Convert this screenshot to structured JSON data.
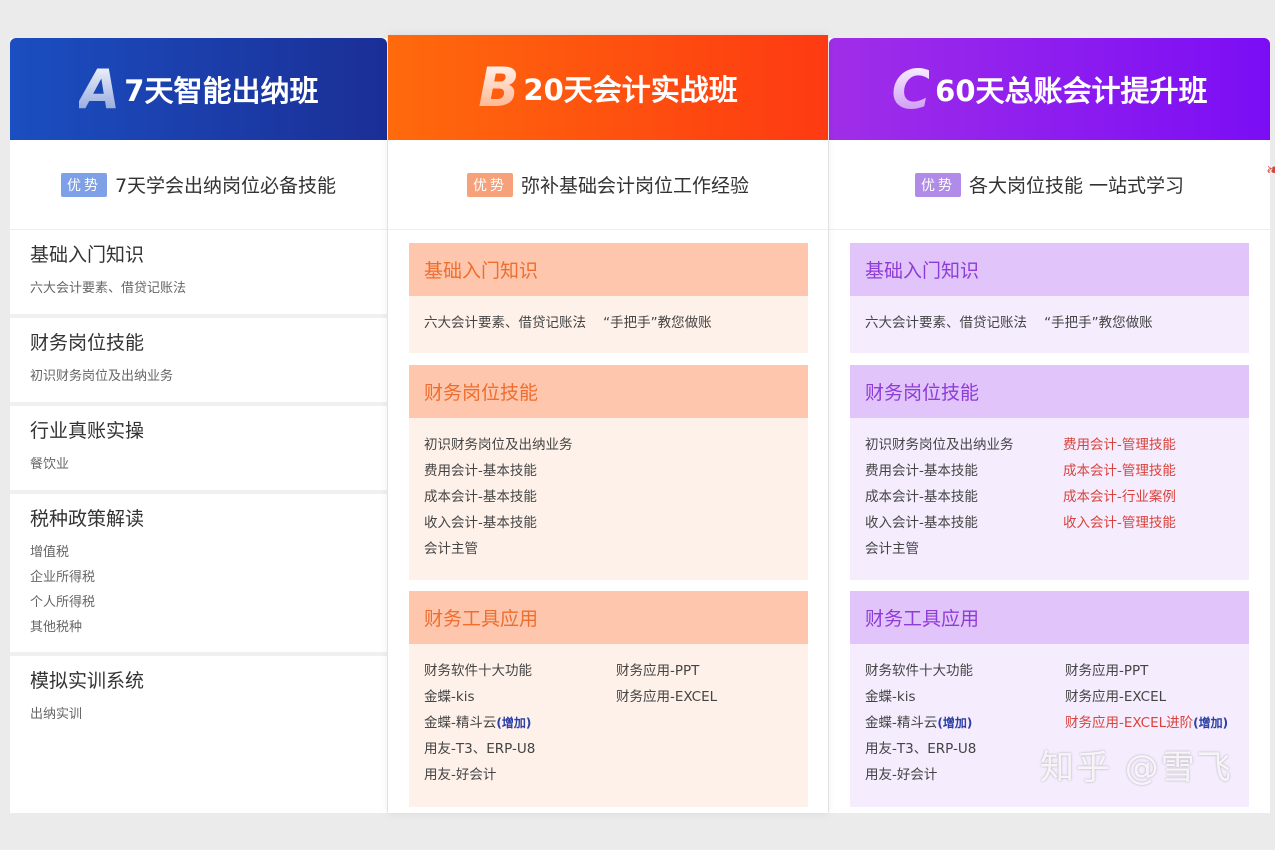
{
  "plans": {
    "a": {
      "letter": "A",
      "title": "7天智能出纳班",
      "badge": "优势",
      "advantage": "7天学会出纳岗位必备技能",
      "items": [
        {
          "title": "基础入门知识",
          "subs": [
            "六大会计要素、借贷记账法"
          ]
        },
        {
          "title": "财务岗位技能",
          "subs": [
            "初识财务岗位及出纳业务"
          ]
        },
        {
          "title": "行业真账实操",
          "subs": [
            "餐饮业"
          ]
        },
        {
          "title": "税种政策解读",
          "subs": [
            "增值税",
            "企业所得税",
            "个人所得税",
            "其他税种"
          ]
        },
        {
          "title": "模拟实训系统",
          "subs": [
            "出纳实训"
          ]
        }
      ]
    },
    "b": {
      "letter": "B",
      "title": "20天会计实战班",
      "badge": "优势",
      "advantage": "弥补基础会计岗位工作经验",
      "sections": [
        {
          "title": "基础入门知识",
          "rows": [
            [
              "六大会计要素、借贷记账法    “手把手”教您做账"
            ]
          ]
        },
        {
          "title": "财务岗位技能",
          "rows": [
            [
              "初识财务岗位及出纳业务"
            ],
            [
              "费用会计-基本技能"
            ],
            [
              "成本会计-基本技能"
            ],
            [
              "收入会计-基本技能"
            ],
            [
              "会计主管"
            ]
          ]
        },
        {
          "title": "财务工具应用",
          "rows": [
            [
              "财务软件十大功能",
              "财务应用-PPT"
            ],
            [
              "金蝶-kis",
              "财务应用-EXCEL"
            ],
            [
              "金蝶-精斗云",
              ""
            ],
            [
              "用友-T3、ERP-U8",
              ""
            ],
            [
              "用友-好会计",
              ""
            ]
          ],
          "plus": "(增加)"
        }
      ]
    },
    "c": {
      "letter": "C",
      "title": "60天总账会计提升班",
      "badge": "优势",
      "advantage": "各大岗位技能 一站式学习",
      "sections": [
        {
          "title": "基础入门知识",
          "rows": [
            [
              "六大会计要素、借贷记账法    “手把手”教您做账"
            ]
          ]
        },
        {
          "title": "财务岗位技能",
          "rows": [
            [
              "初识财务岗位及出纳业务",
              "费用会计-管理技能"
            ],
            [
              "费用会计-基本技能",
              "成本会计-管理技能"
            ],
            [
              "成本会计-基本技能",
              "成本会计-行业案例"
            ],
            [
              "收入会计-基本技能",
              "收入会计-管理技能"
            ],
            [
              "会计主管",
              ""
            ]
          ]
        },
        {
          "title": "财务工具应用",
          "rows": [
            [
              "财务软件十大功能",
              "财务应用-PPT"
            ],
            [
              "金蝶-kis",
              "财务应用-EXCEL"
            ],
            [
              "金蝶-精斗云",
              "财务应用-EXCEL进阶"
            ],
            [
              "用友-T3、ERP-U8",
              ""
            ],
            [
              "用友-好会计",
              ""
            ]
          ],
          "plus": "(增加)"
        }
      ]
    }
  },
  "watermark": "知乎 @雪飞",
  "colors": {
    "a_header": "#1b3fae",
    "b_header": "#ff5210",
    "c_header": "#8a1cf0",
    "highlight_red": "#d9433b"
  }
}
